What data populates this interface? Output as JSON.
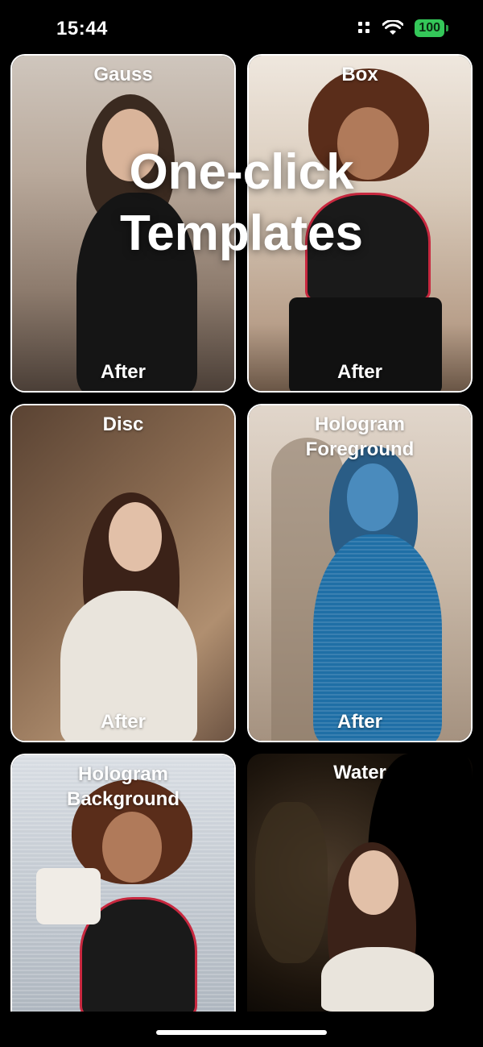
{
  "status_bar": {
    "time": "15:44",
    "battery": "100",
    "icons": [
      "signal-dots-icon",
      "wifi-icon",
      "battery-icon"
    ]
  },
  "hero": {
    "title_line1": "One-click",
    "title_line2": "Templates"
  },
  "templates": [
    {
      "name": "Gauss",
      "after": "After"
    },
    {
      "name": "Box",
      "after": "After"
    },
    {
      "name": "Disc",
      "after": "After"
    },
    {
      "name": "Hologram Foreground",
      "after": "After"
    },
    {
      "name": "Hologram Background"
    },
    {
      "name": "Water"
    }
  ],
  "colors": {
    "background": "#000000",
    "battery": "#34c759",
    "card_border": "#ffffff",
    "hologram": "#1f6fa6"
  }
}
